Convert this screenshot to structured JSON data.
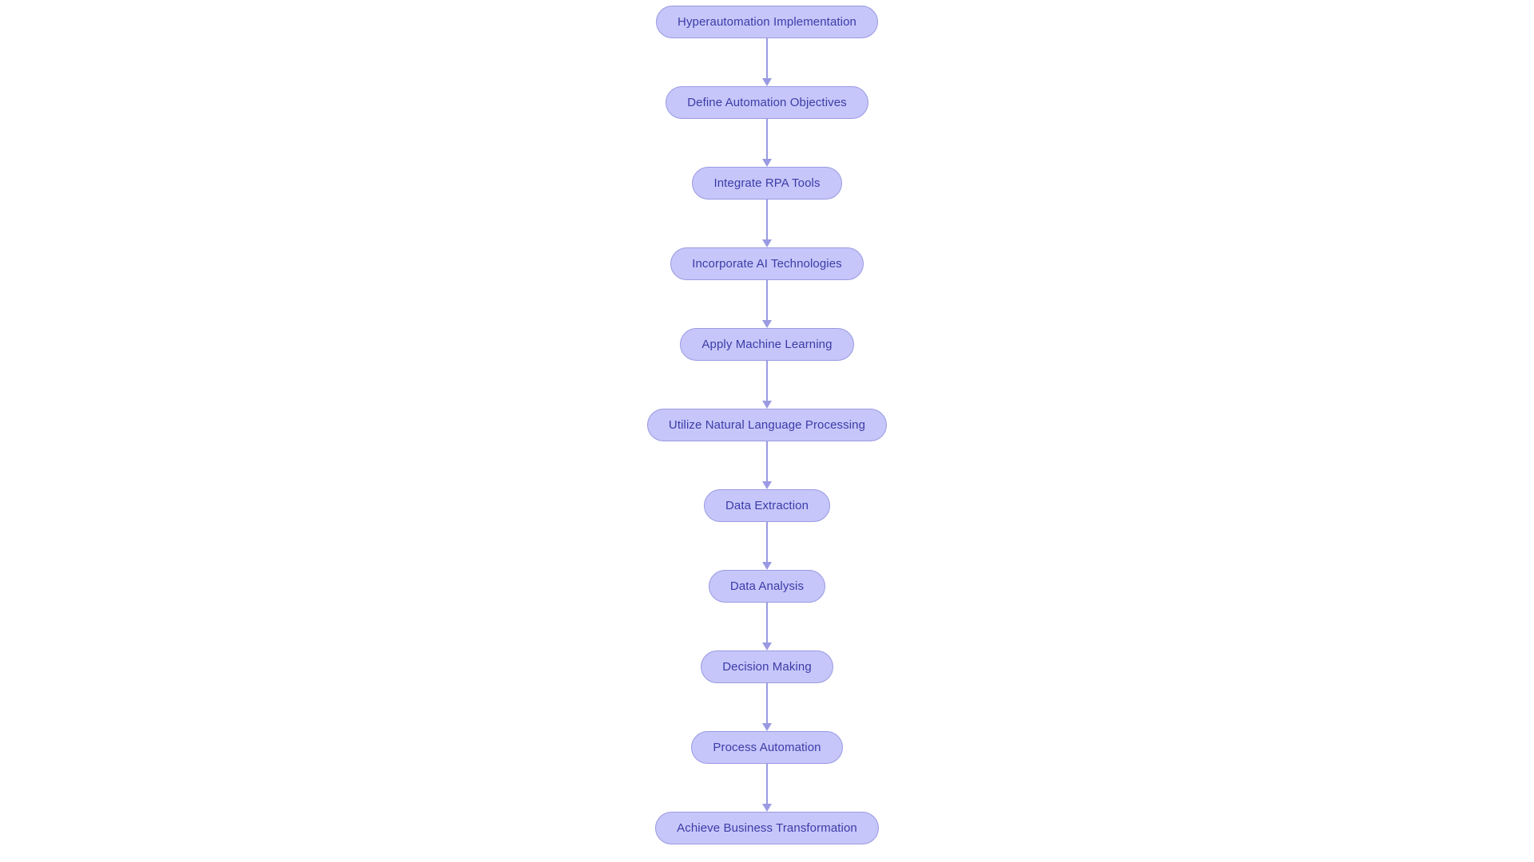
{
  "diagram": {
    "type": "flowchart",
    "orientation": "vertical",
    "title": "Hyperautomation Implementation",
    "background_color": "#ffffff",
    "node_fill_color": "#c6c6fa",
    "node_border_color": "#9a9ae2",
    "node_text_color": "#3c3ca8",
    "connector_color": "#9a9ae2",
    "nodes": [
      {
        "id": "n1",
        "label": "Hyperautomation Implementation"
      },
      {
        "id": "n2",
        "label": "Define Automation Objectives"
      },
      {
        "id": "n3",
        "label": "Integrate RPA Tools"
      },
      {
        "id": "n4",
        "label": "Incorporate AI Technologies"
      },
      {
        "id": "n5",
        "label": "Apply Machine Learning"
      },
      {
        "id": "n6",
        "label": "Utilize Natural Language Processing"
      },
      {
        "id": "n7",
        "label": "Data Extraction"
      },
      {
        "id": "n8",
        "label": "Data Analysis"
      },
      {
        "id": "n9",
        "label": "Decision Making"
      },
      {
        "id": "n10",
        "label": "Process Automation"
      },
      {
        "id": "n11",
        "label": "Achieve Business Transformation"
      }
    ],
    "edges": [
      {
        "from": "n1",
        "to": "n2",
        "arrow": "down"
      },
      {
        "from": "n2",
        "to": "n3",
        "arrow": "down"
      },
      {
        "from": "n3",
        "to": "n4",
        "arrow": "down"
      },
      {
        "from": "n4",
        "to": "n5",
        "arrow": "down"
      },
      {
        "from": "n5",
        "to": "n6",
        "arrow": "down"
      },
      {
        "from": "n6",
        "to": "n7",
        "arrow": "down"
      },
      {
        "from": "n7",
        "to": "n8",
        "arrow": "down"
      },
      {
        "from": "n8",
        "to": "n9",
        "arrow": "down"
      },
      {
        "from": "n9",
        "to": "n10",
        "arrow": "down"
      },
      {
        "from": "n10",
        "to": "n11",
        "arrow": "down"
      }
    ]
  }
}
